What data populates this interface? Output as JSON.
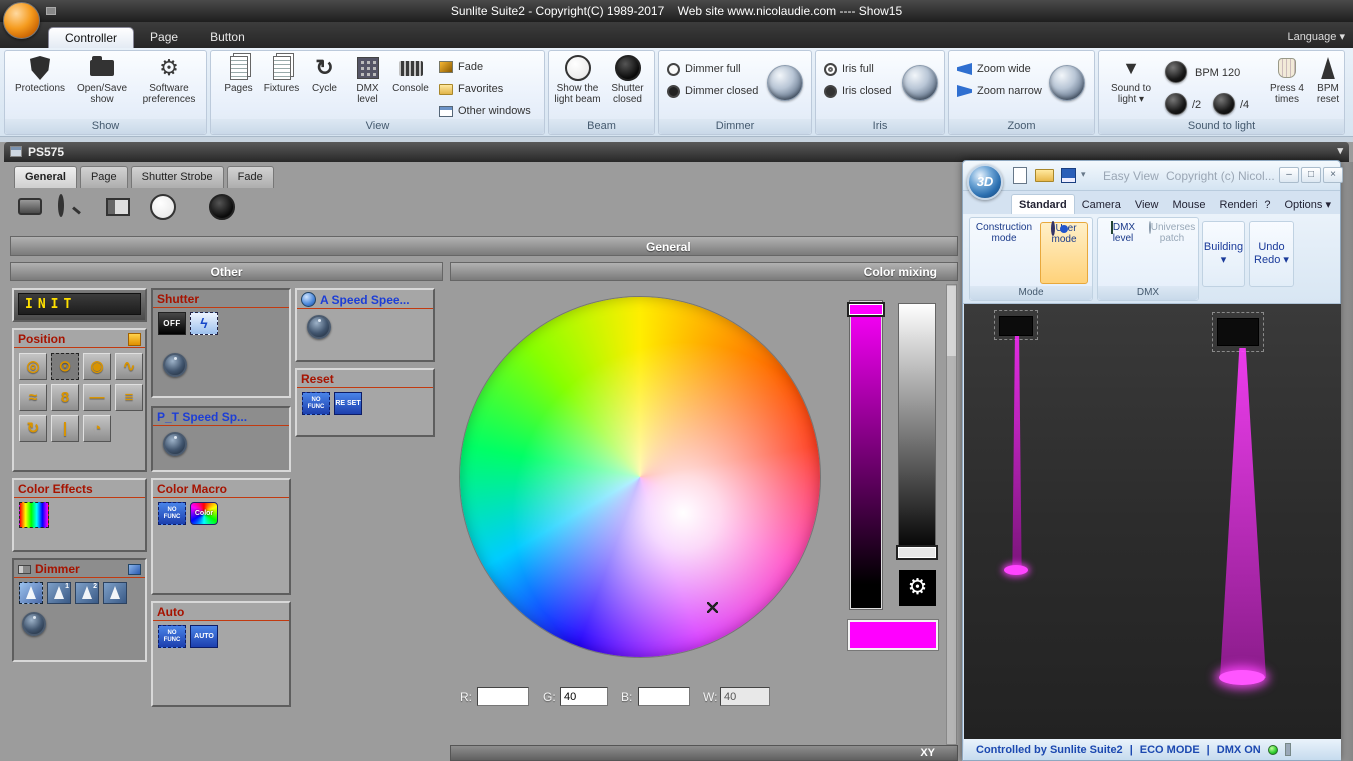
{
  "glyphs": {
    "arrow_down": "▾",
    "gear": "⚙",
    "cycle": "↻",
    "min": "–",
    "max": "□",
    "close": "×",
    "bolt": "ϟ"
  },
  "colors": {
    "beam": "#ff00ff",
    "preview": "#ff00ff",
    "accent_red": "#a61300",
    "accent_blue": "#1d3ed6"
  },
  "titlebar": {
    "title": "Sunlite Suite2 - Copyright(C) 1989-2017    Web site www.nicolaudie.com ---- Show15"
  },
  "nav": {
    "tabs": [
      "Controller",
      "Page",
      "Button"
    ],
    "language": "Language"
  },
  "ribbon": {
    "show": {
      "label": "Show",
      "b1": "Protections",
      "b2": "Open/Save show",
      "b3": "Software preferences"
    },
    "view": {
      "label": "View",
      "b1": "Pages",
      "b2": "Fixtures",
      "b3": "Cycle",
      "b4": "DMX level",
      "b5": "Console",
      "s1": "Fade",
      "s2": "Favorites",
      "s3": "Other windows"
    },
    "beam": {
      "label": "Beam",
      "b1": "Show the light beam",
      "b2": "Shutter closed"
    },
    "dimmer": {
      "label": "Dimmer",
      "s1": "Dimmer full",
      "s2": "Dimmer closed"
    },
    "iris": {
      "label": "Iris",
      "s1": "Iris full",
      "s2": "Iris closed"
    },
    "zoom": {
      "label": "Zoom",
      "s1": "Zoom wide",
      "s2": "Zoom narrow"
    },
    "sound": {
      "label": "Sound to light",
      "b1": "Sound to light",
      "bpm": "BPM 120",
      "d2": "/2",
      "d4": "/4",
      "b2": "Press 4 times",
      "b3": "BPM reset"
    }
  },
  "ps": {
    "title": "PS575",
    "tabs": [
      "General",
      "Page",
      "Shutter Strobe",
      "Fade"
    ],
    "section": "General",
    "other": {
      "title": "Other",
      "init": "INIT",
      "position": "Position",
      "pos_icons": [
        "◎",
        "⊙",
        "◉",
        "∿",
        "≈",
        "8",
        "—",
        "≡",
        "↻",
        "|",
        "◔"
      ],
      "color_effects": "Color Effects",
      "dimmer": "Dimmer",
      "d1": "1",
      "d2": "2",
      "shutter": "Shutter",
      "off": "OFF",
      "pt_speed": "P_T Speed Sp...",
      "color_macro": "Color Macro",
      "auto": "Auto",
      "auto_icon": "AUTO",
      "a_speed": "A Speed Spee...",
      "reset": "Reset",
      "reset_icon": "RE SET",
      "no_func": "NO FUNC",
      "color_icon": "Color"
    },
    "mix": {
      "title": "Color mixing",
      "r": "R:",
      "g": "G:",
      "b": "B:",
      "w": "W:",
      "rv": "",
      "gv": "40",
      "bv": "",
      "wv": "40",
      "xy": "XY"
    }
  },
  "ev": {
    "logo": "3D",
    "title": "Easy View",
    "copyright": "Copyright (c) Nicol...",
    "tabs": [
      "Standard",
      "Camera",
      "View",
      "Mouse",
      "Rendering"
    ],
    "help": "?",
    "options": "Options",
    "construction": "Construction mode",
    "user": "User mode",
    "dmx_level": "DMX level",
    "universes": "Universes patch",
    "mode": "Mode",
    "dmx": "DMX",
    "building": "Building",
    "undo": "Undo",
    "redo": "Redo",
    "status1": "Controlled by Sunlite Suite2",
    "sep": "|",
    "status2": "ECO MODE",
    "status3": "DMX ON"
  }
}
